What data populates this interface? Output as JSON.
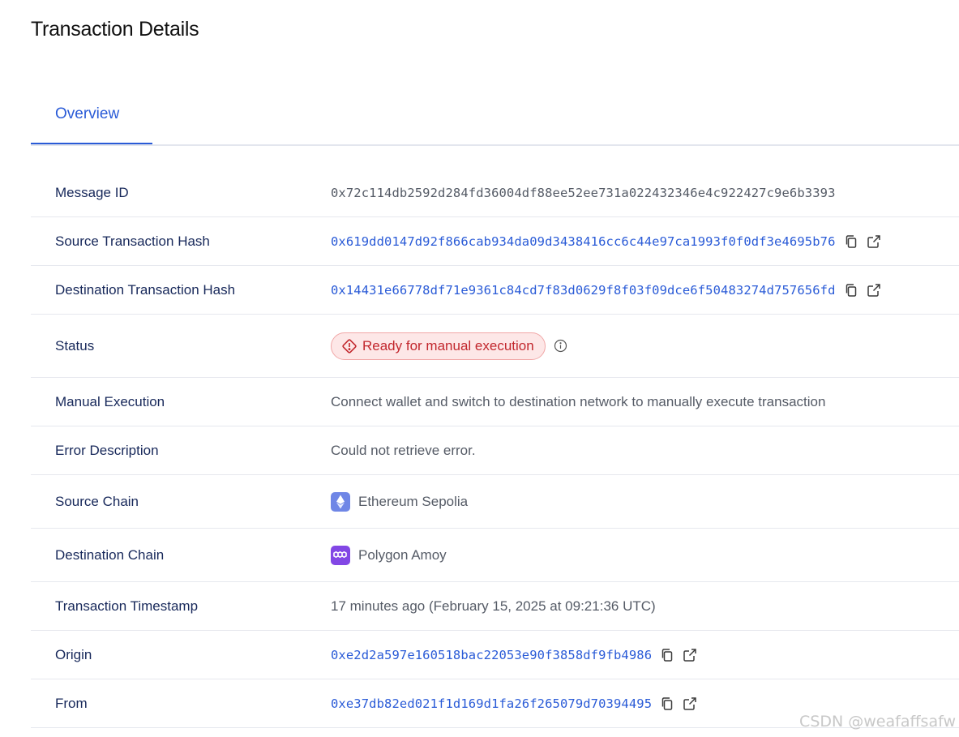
{
  "page": {
    "title": "Transaction Details"
  },
  "tabs": [
    {
      "label": "Overview",
      "active": true
    }
  ],
  "rows": {
    "message_id": {
      "label": "Message ID",
      "value": "0x72c114db2592d284fd36004df88ee52ee731a022432346e4c922427c9e6b3393"
    },
    "source_tx_hash": {
      "label": "Source Transaction Hash",
      "value": "0x619dd0147d92f866cab934da09d3438416cc6c44e97ca1993f0f0df3e4695b76"
    },
    "dest_tx_hash": {
      "label": "Destination Transaction Hash",
      "value": "0x14431e66778df71e9361c84cd7f83d0629f8f03f09dce6f50483274d757656fd"
    },
    "status": {
      "label": "Status",
      "value": "Ready for manual execution"
    },
    "manual_execution": {
      "label": "Manual Execution",
      "value": "Connect wallet and switch to destination network to manually execute transaction"
    },
    "error_description": {
      "label": "Error Description",
      "value": "Could not retrieve error."
    },
    "source_chain": {
      "label": "Source Chain",
      "value": "Ethereum Sepolia"
    },
    "destination_chain": {
      "label": "Destination Chain",
      "value": "Polygon Amoy"
    },
    "timestamp": {
      "label": "Transaction Timestamp",
      "value": "17 minutes ago (February 15, 2025 at 09:21:36 UTC)"
    },
    "origin": {
      "label": "Origin",
      "value": "0xe2d2a597e160518bac22053e90f3858df9fb4986"
    },
    "from": {
      "label": "From",
      "value": "0xe37db82ed021f1d169d1fa26f265079d70394495"
    }
  },
  "colors": {
    "accent": "#2a5bd7",
    "label": "#17285a",
    "value": "#555b66",
    "status_bg": "#fde7e7",
    "status_text": "#c2272d",
    "ethereum": "#6f86e6",
    "polygon": "#8247e5"
  },
  "icons": {
    "copy": "copy-icon",
    "external": "external-link-icon",
    "warning": "warning-diamond-icon",
    "info": "info-icon",
    "ethereum": "ethereum-logo-icon",
    "polygon": "polygon-logo-icon"
  },
  "watermark": "CSDN @weafaffsafw"
}
